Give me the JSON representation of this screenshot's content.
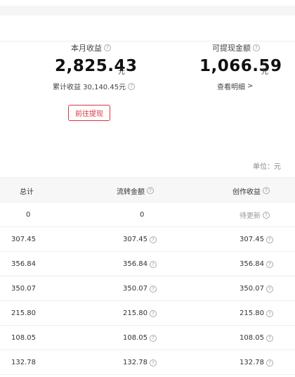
{
  "summary": {
    "monthly": {
      "label": "本月收益",
      "value": "2,825.43",
      "unit": "元",
      "cumulative": "累计收益 30,140.45元"
    },
    "withdrawable": {
      "label": "可提现金额",
      "value": "1,066.59",
      "unit": "元",
      "details_link": "查看明细",
      "details_chevron": ">"
    },
    "withdraw_button": "前往提现"
  },
  "unit_note": "单位：元",
  "table": {
    "headers": {
      "total": "总计",
      "flow": "流转金额",
      "creation": "创作收益"
    },
    "rows": [
      {
        "total": "0",
        "flow": "0",
        "creation": "待更新"
      },
      {
        "total": "307.45",
        "flow": "307.45",
        "creation": "307.45"
      },
      {
        "total": "356.84",
        "flow": "356.84",
        "creation": "356.84"
      },
      {
        "total": "350.07",
        "flow": "350.07",
        "creation": "350.07"
      },
      {
        "total": "215.80",
        "flow": "215.80",
        "creation": "215.80"
      },
      {
        "total": "108.05",
        "flow": "108.05",
        "creation": "108.05"
      },
      {
        "total": "132.78",
        "flow": "132.78",
        "creation": "132.78"
      }
    ]
  },
  "colors": {
    "accent": "#d9363e"
  }
}
